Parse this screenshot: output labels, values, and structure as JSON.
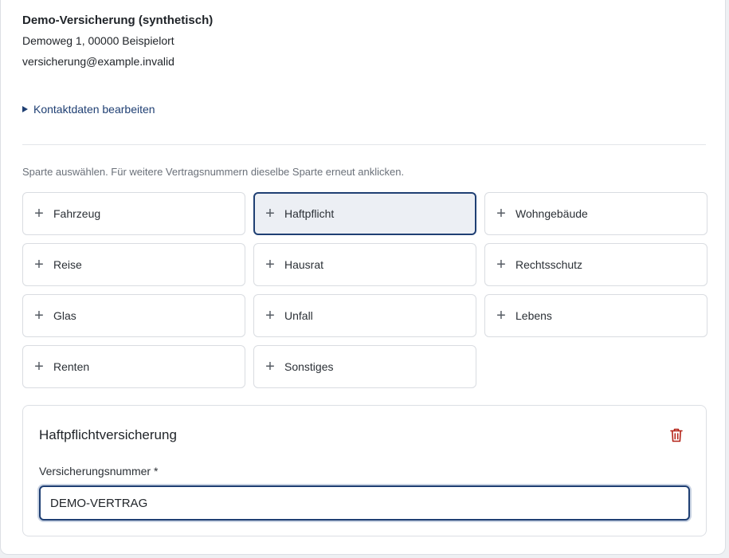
{
  "contact": {
    "company_name": "Demo-Versicherung (synthetisch)",
    "address": "Demoweg 1, 00000 Beispielort",
    "email": "versicherung@example.invalid",
    "edit_label": "Kontaktdaten bearbeiten"
  },
  "categories": {
    "hint": "Sparte auswählen. Für weitere Vertragsnummern dieselbe Sparte erneut anklicken.",
    "items": [
      {
        "label": "Fahrzeug",
        "icon": "plus-icon"
      },
      {
        "label": "Haftpflicht",
        "icon": "plus-icon",
        "selected": true
      },
      {
        "label": "Wohngebäude",
        "icon": "plus-icon"
      },
      {
        "label": "Reise",
        "icon": "plus-icon"
      },
      {
        "label": "Hausrat",
        "icon": "plus-icon"
      },
      {
        "label": "Rechtsschutz",
        "icon": "plus-icon"
      },
      {
        "label": "Glas",
        "icon": "plus-icon"
      },
      {
        "label": "Unfall",
        "icon": "plus-icon"
      },
      {
        "label": "Lebens",
        "icon": "plus-icon"
      },
      {
        "label": "Renten",
        "icon": "plus-icon"
      },
      {
        "label": "Sonstiges",
        "icon": "plus-icon"
      }
    ]
  },
  "policy": {
    "title": "Haftpflichtversicherung",
    "delete_icon": "trash-icon",
    "field_label": "Versicherungsnummer *",
    "field_value": "DEMO-VERTRAG"
  },
  "colors": {
    "accent": "#1f3f73",
    "danger": "#b42318",
    "selected_bg": "#eceff4"
  }
}
